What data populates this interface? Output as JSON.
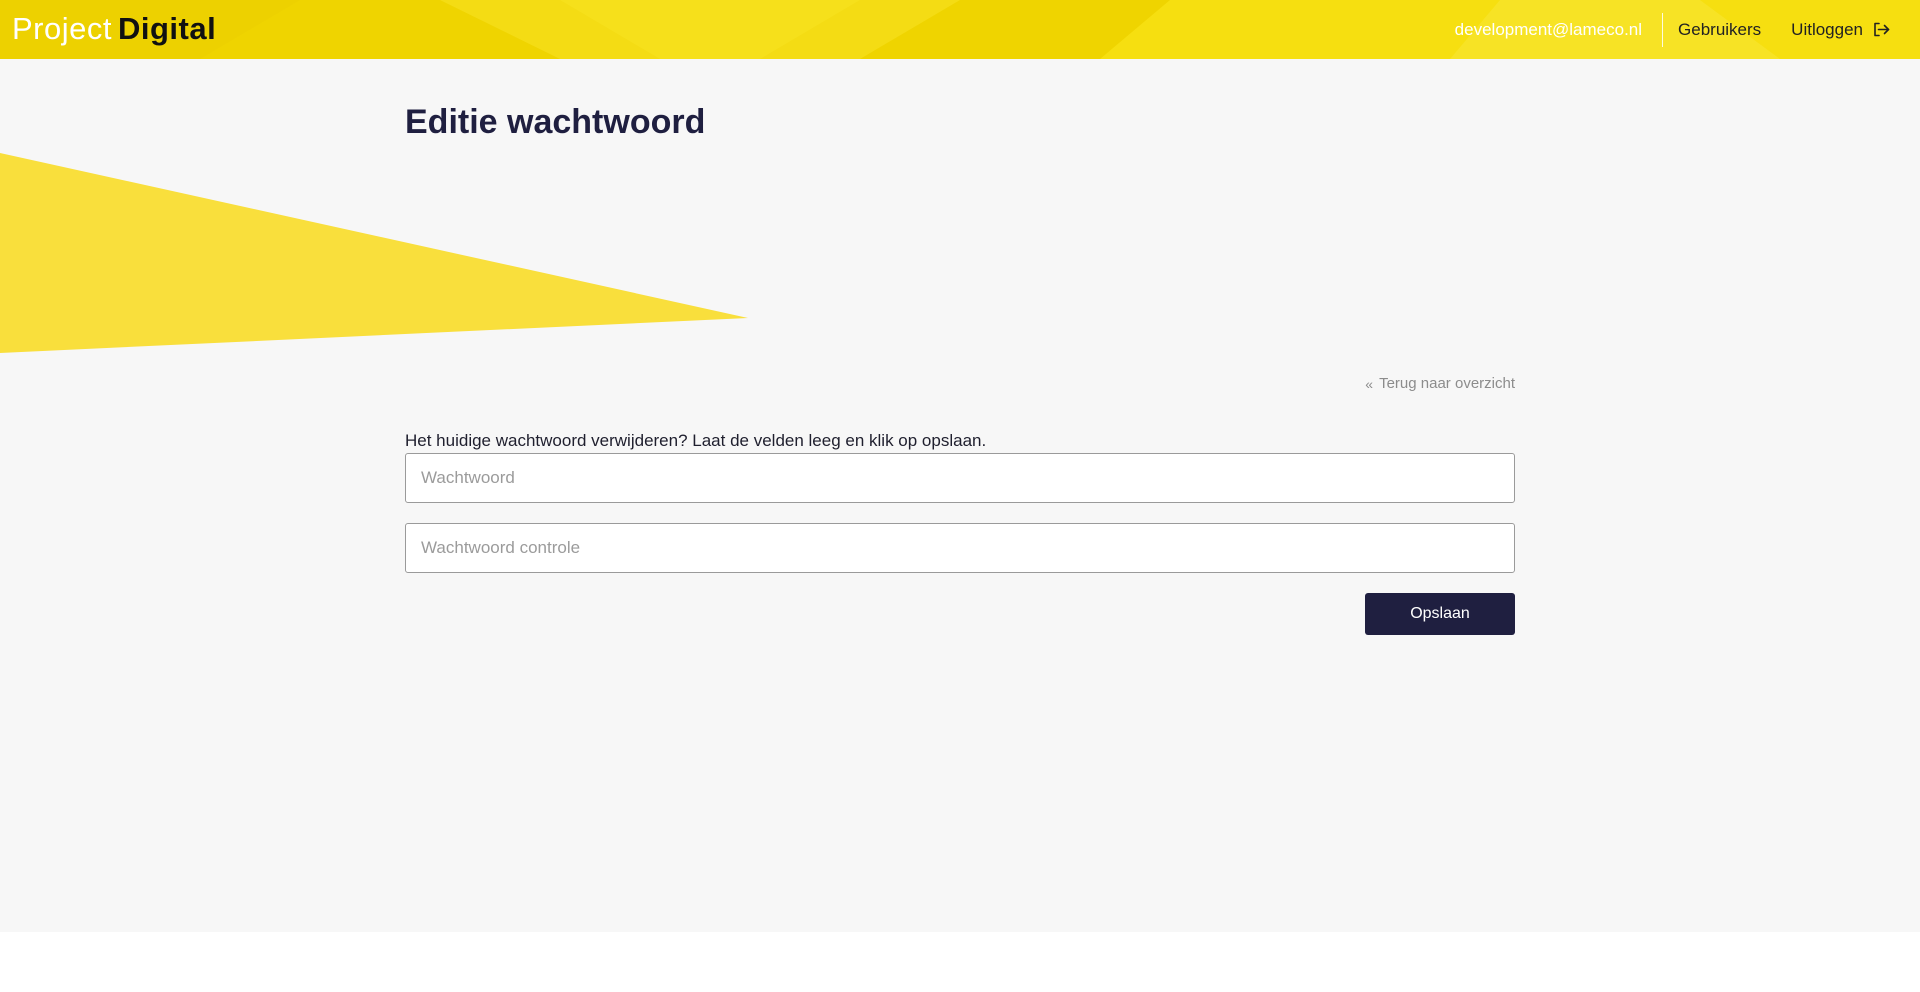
{
  "header": {
    "brand_light": "Project",
    "brand_bold": "Digital",
    "user_email": "development@lameco.nl",
    "users_link": "Gebruikers",
    "logout_link": "Uitloggen",
    "logout_icon": "logout-icon"
  },
  "main": {
    "title": "Editie wachtwoord",
    "back_link": "Terug naar overzicht",
    "back_icon": "double-chevron-left-icon",
    "intro_text": "Het huidige wachtwoord verwijderen? Laat de velden leeg en klik op opslaan.",
    "password_placeholder": "Wachtwoord",
    "password_value": "",
    "password_check_placeholder": "Wachtwoord controle",
    "password_check_value": "",
    "save_label": "Opslaan"
  },
  "colors": {
    "header_yellow": "#f2d900",
    "accent_yellow": "#f8dc2b",
    "primary_navy": "#1f1f40",
    "page_background": "#f7f7f7"
  }
}
